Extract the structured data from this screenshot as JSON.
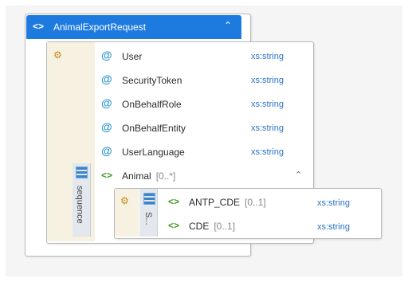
{
  "root": {
    "name": "AnimalExportRequest",
    "collapse_icon": "double-chevron-up"
  },
  "attributes": [
    {
      "name": "User",
      "type": "xs:string"
    },
    {
      "name": "SecurityToken",
      "type": "xs:string"
    },
    {
      "name": "OnBehalfRole",
      "type": "xs:string"
    },
    {
      "name": "OnBehalfEntity",
      "type": "xs:string"
    },
    {
      "name": "UserLanguage",
      "type": "xs:string"
    }
  ],
  "sequence": {
    "label": "sequence",
    "element": {
      "name": "Animal",
      "occurrence": "[0..*]"
    }
  },
  "inner_sequence": {
    "label": "S...",
    "elements": [
      {
        "name": "ANTP_CDE",
        "occurrence": "[0..1]",
        "type": "xs:string"
      },
      {
        "name": "CDE",
        "occurrence": "[0..1]",
        "type": "xs:string"
      }
    ]
  }
}
